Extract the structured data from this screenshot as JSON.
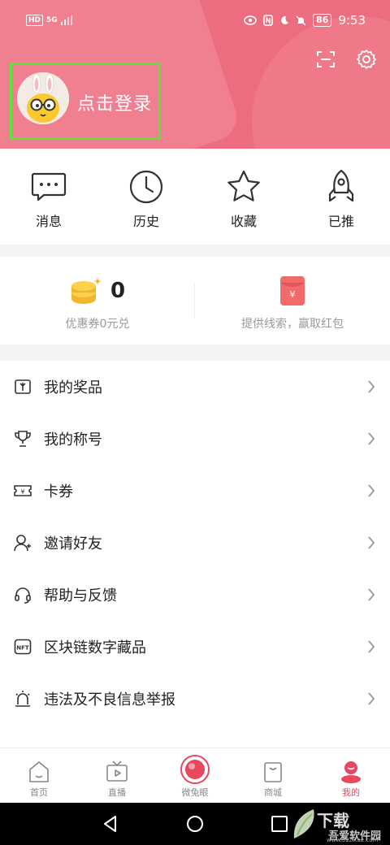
{
  "status_bar": {
    "hd": "HD",
    "network": "5G",
    "battery": "86",
    "time": "9:53"
  },
  "header": {
    "login_text": "点击登录",
    "accent": "#ec6d80"
  },
  "quick_actions": [
    {
      "label": "消息",
      "icon": "message-icon"
    },
    {
      "label": "历史",
      "icon": "clock-icon"
    },
    {
      "label": "收藏",
      "icon": "star-icon"
    },
    {
      "label": "已推",
      "icon": "rocket-icon"
    }
  ],
  "coupon": {
    "count": "0",
    "coupon_text": "优惠券0元兑",
    "clue_text": "提供线索，赢取红包"
  },
  "menu": [
    {
      "label": "我的奖品",
      "icon": "gift-icon"
    },
    {
      "label": "我的称号",
      "icon": "trophy-icon"
    },
    {
      "label": "卡券",
      "icon": "ticket-icon"
    },
    {
      "label": "邀请好友",
      "icon": "add-user-icon"
    },
    {
      "label": "帮助与反馈",
      "icon": "headset-icon"
    },
    {
      "label": "区块链数字藏品",
      "icon": "nft-icon"
    },
    {
      "label": "违法及不良信息举报",
      "icon": "alarm-icon"
    }
  ],
  "tabs": [
    {
      "label": "首页",
      "icon": "home-icon"
    },
    {
      "label": "直播",
      "icon": "tv-icon"
    },
    {
      "label": "微兔眼",
      "icon": "eye-ball-icon"
    },
    {
      "label": "商城",
      "icon": "shopping-bag-icon"
    },
    {
      "label": "我的",
      "icon": "profile-icon",
      "active": true
    }
  ],
  "watermark": {
    "title": "下载",
    "subtitle": "吾爱软件园",
    "url": "www.52zixue.com"
  }
}
